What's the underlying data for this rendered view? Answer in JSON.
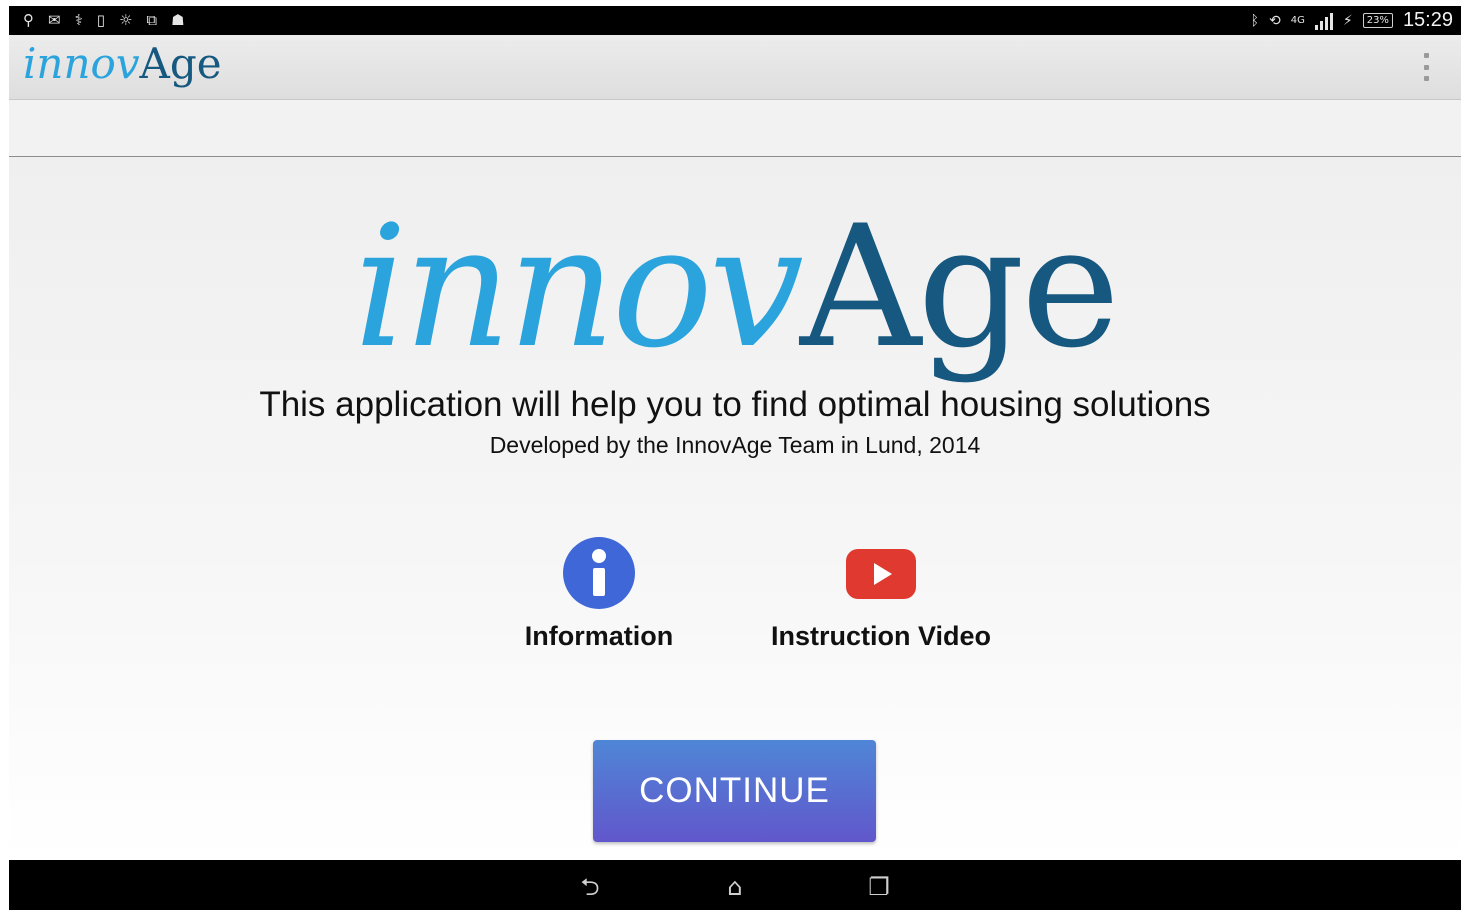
{
  "status_bar": {
    "left_icons": [
      "usb-icon",
      "gmail-icon",
      "usb-debug-icon",
      "screenshot-icon",
      "bulb-icon",
      "sync-icon",
      "android-icon"
    ],
    "network": "4G",
    "battery": "23%",
    "time": "15:29"
  },
  "action_bar": {
    "logo_part1": "innov",
    "logo_part2": "Age",
    "menu_icon": "overflow-menu-icon"
  },
  "main": {
    "logo_part1": "innov",
    "logo_part2": "Age",
    "headline": "This application will help you to find optimal housing solutions",
    "subline": "Developed by the InnovAge Team in Lund, 2014",
    "info_label": "Information",
    "video_label": "Instruction Video",
    "continue_label": "CONTINUE"
  },
  "nav_bar": {
    "back_glyph": "⮌",
    "home_glyph": "⌂",
    "recent_glyph": "❐"
  },
  "colors": {
    "logo_light_blue": "#2ba3dc",
    "logo_dark_blue": "#16587f",
    "info_blue": "#3f67d8",
    "video_red": "#e03a30",
    "button_gradient_top": "#4f86d6",
    "button_gradient_bottom": "#6157cc"
  }
}
